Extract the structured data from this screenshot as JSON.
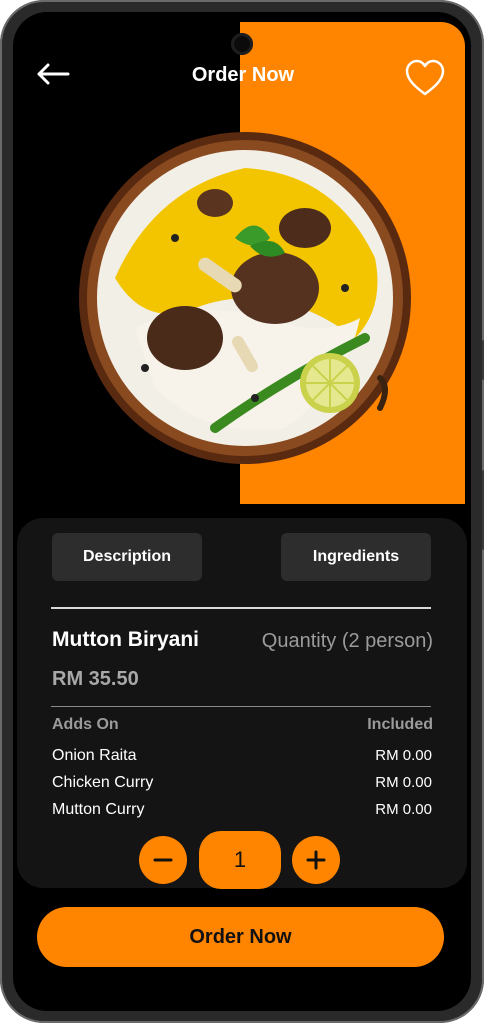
{
  "header": {
    "title": "Order Now",
    "back_icon": "arrow-left-icon",
    "favorite_icon": "heart-icon"
  },
  "colors": {
    "accent": "#ff8500",
    "background": "#000000",
    "card": "#141414",
    "tab": "#2d2d2d"
  },
  "tabs": [
    {
      "label": "Description"
    },
    {
      "label": "Ingredients"
    }
  ],
  "dish": {
    "name": "Mutton Biryani",
    "quantity_label": "Quantity (2 person)",
    "price": "RM 35.50"
  },
  "addons": {
    "heading": "Adds On",
    "included_label": "Included",
    "items": [
      {
        "name": "Onion Raita",
        "price": "RM 0.00"
      },
      {
        "name": "Chicken Curry",
        "price": "RM 0.00"
      },
      {
        "name": "Mutton Curry",
        "price": "RM 0.00"
      }
    ]
  },
  "quantity": {
    "value": "1",
    "minus_icon": "minus-icon",
    "plus_icon": "plus-icon"
  },
  "order_button": {
    "label": "Order Now"
  }
}
